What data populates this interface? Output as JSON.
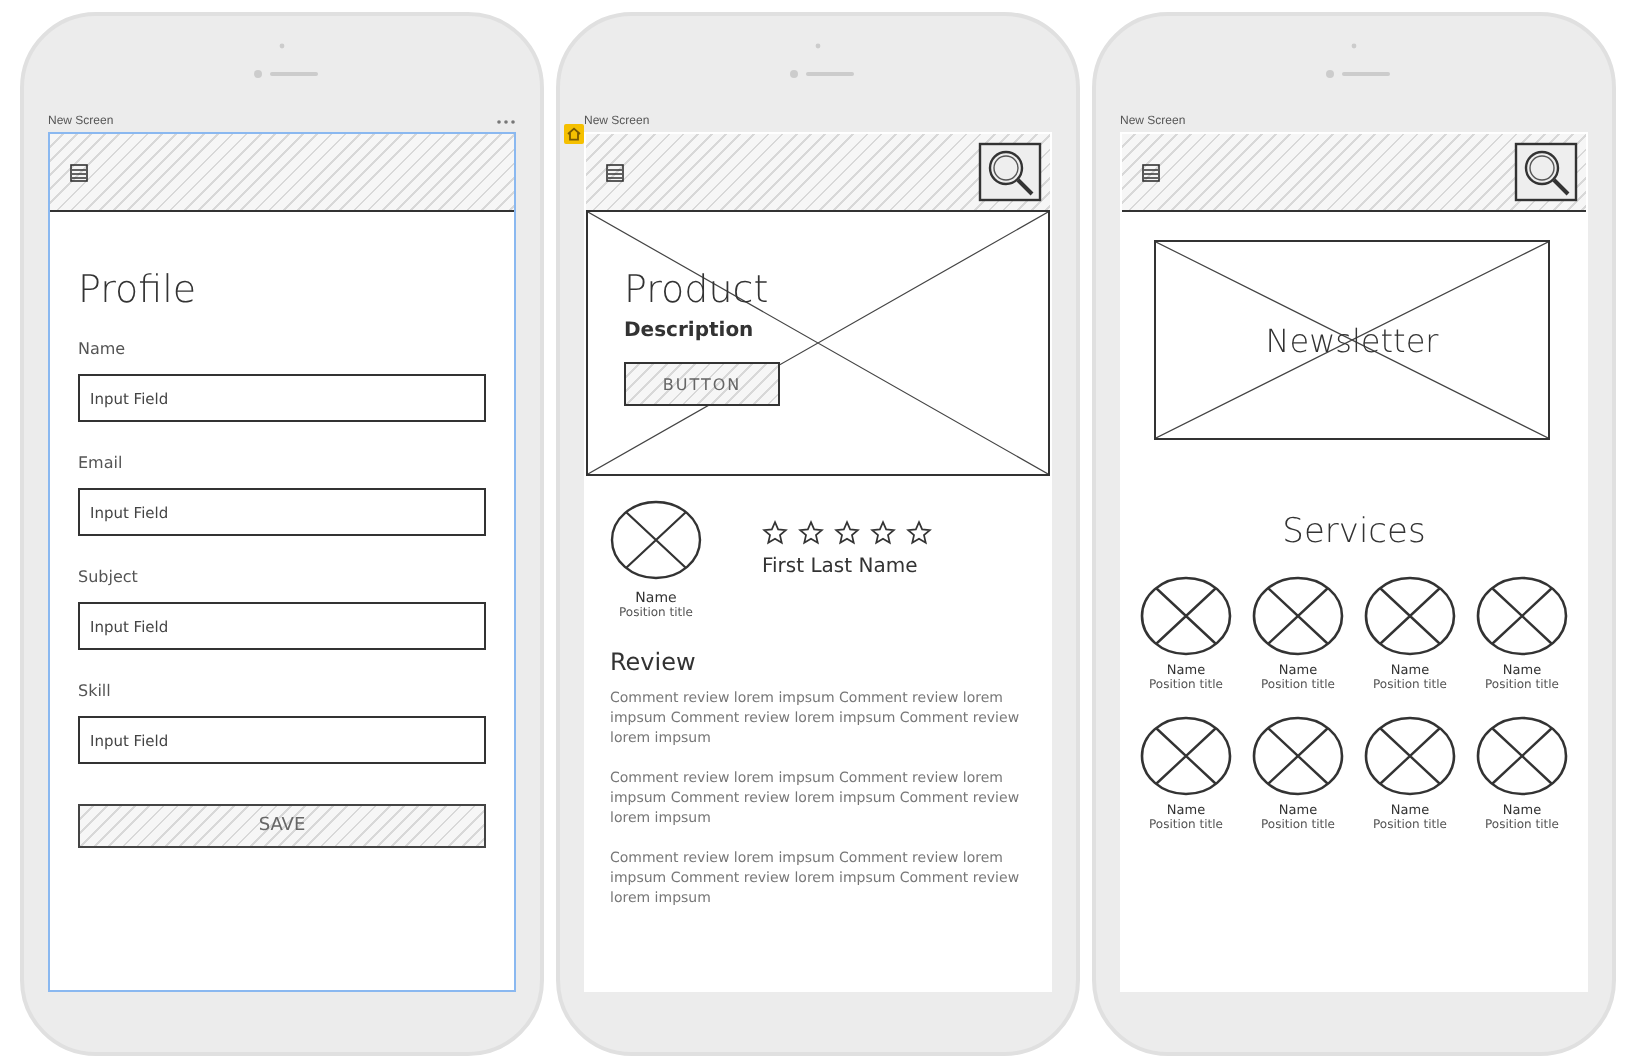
{
  "phones": [
    {
      "kind": "profile",
      "label": "New Screen",
      "selected": true,
      "home": false,
      "title": "Profile",
      "fields": [
        {
          "label": "Name",
          "placeholder": "Input Field"
        },
        {
          "label": "Email",
          "placeholder": "Input Field"
        },
        {
          "label": "Subject",
          "placeholder": "Input Field"
        },
        {
          "label": "Skill",
          "placeholder": "Input Field"
        }
      ],
      "button": "SAVE"
    },
    {
      "kind": "product",
      "label": "New Screen",
      "selected": false,
      "home": true,
      "hero": {
        "title": "Product",
        "subtitle": "Description",
        "button": "BUTTON"
      },
      "profile": {
        "name": "Name",
        "position": "Position title",
        "stars": 0,
        "full_name": "First Last Name"
      },
      "review": {
        "title": "Review",
        "comments": [
          "Comment review lorem impsum Comment review lorem impsum Comment review lorem impsum Comment review lorem impsum",
          "Comment review lorem impsum Comment review lorem impsum Comment review lorem impsum Comment review lorem impsum",
          "Comment review lorem impsum Comment review lorem impsum Comment review lorem impsum Comment review lorem impsum"
        ]
      }
    },
    {
      "kind": "newsletter",
      "label": "New Screen",
      "selected": false,
      "home": false,
      "banner": "Newsletter",
      "title": "Services",
      "people": [
        {
          "name": "Name",
          "position": "Position title"
        },
        {
          "name": "Name",
          "position": "Position title"
        },
        {
          "name": "Name",
          "position": "Position title"
        },
        {
          "name": "Name",
          "position": "Position title"
        },
        {
          "name": "Name",
          "position": "Position title"
        },
        {
          "name": "Name",
          "position": "Position title"
        },
        {
          "name": "Name",
          "position": "Position title"
        },
        {
          "name": "Name",
          "position": "Position title"
        }
      ]
    }
  ]
}
